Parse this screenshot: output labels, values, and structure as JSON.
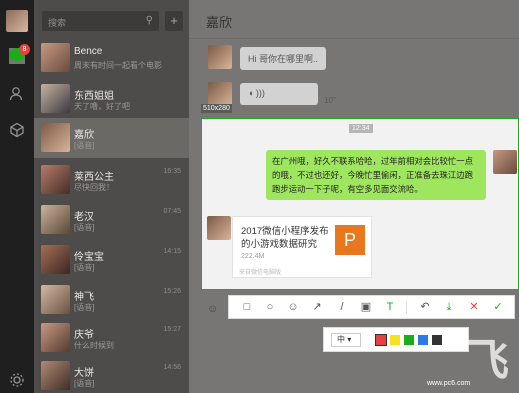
{
  "rail": {
    "chat_badge": "8"
  },
  "search": {
    "placeholder": "搜索",
    "add_label": "+"
  },
  "conversations": [
    {
      "name": "Bence",
      "preview": "周末有时间一起看个电影",
      "time": ""
    },
    {
      "name": "东西姐姐",
      "preview": "天了噜，好了吧",
      "time": ""
    },
    {
      "name": "嘉欣",
      "preview": "[语音]",
      "time": ""
    },
    {
      "name": "莱西公主",
      "preview": "尽快回我！",
      "time": "16:35"
    },
    {
      "name": "老汉",
      "preview": "[语音]",
      "time": "07:45"
    },
    {
      "name": "伶宝宝",
      "preview": "[语音]",
      "time": "14:15"
    },
    {
      "name": "神飞",
      "preview": "[语音]",
      "time": "15:26"
    },
    {
      "name": "庆爷",
      "preview": "什么时候到",
      "time": "15:27"
    },
    {
      "name": "大饼",
      "preview": "[语音]",
      "time": "14:56"
    }
  ],
  "chat": {
    "title": "嘉欣",
    "msg1": "Hi 哥你在哪里啊..",
    "voice_len": "10\"",
    "size_label": "510x280",
    "timestamp": "12:34",
    "long_msg": "在广州哦，好久不联系哈哈，过年前相对会比较忙一点的哦，不过也还好，今晚忙里偷闲，正准备去珠江边跑跑步运动一下子呢，有空多见面交流哈。",
    "card_title": "2017微信小程序发布的小游戏数据研究",
    "card_size": "222.4M",
    "card_footer": "来自微信电脑版",
    "card_icon_letter": "P"
  },
  "toolbar": {
    "rect": "□",
    "ellipse": "○",
    "mosaic_emoji": "☺",
    "arrow": "↗",
    "pen": "/",
    "mosaic": "▣",
    "text": "T",
    "undo": "↶",
    "save": "⤓",
    "cancel": "✕",
    "done": "✓"
  },
  "text_options": {
    "font_size": "中",
    "colors": [
      "#e64340",
      "#f7e21e",
      "#1aad19",
      "#2a7ae2",
      "#333333"
    ]
  },
  "watermark": {
    "big": "飞",
    "url": "www.pc6.com"
  }
}
